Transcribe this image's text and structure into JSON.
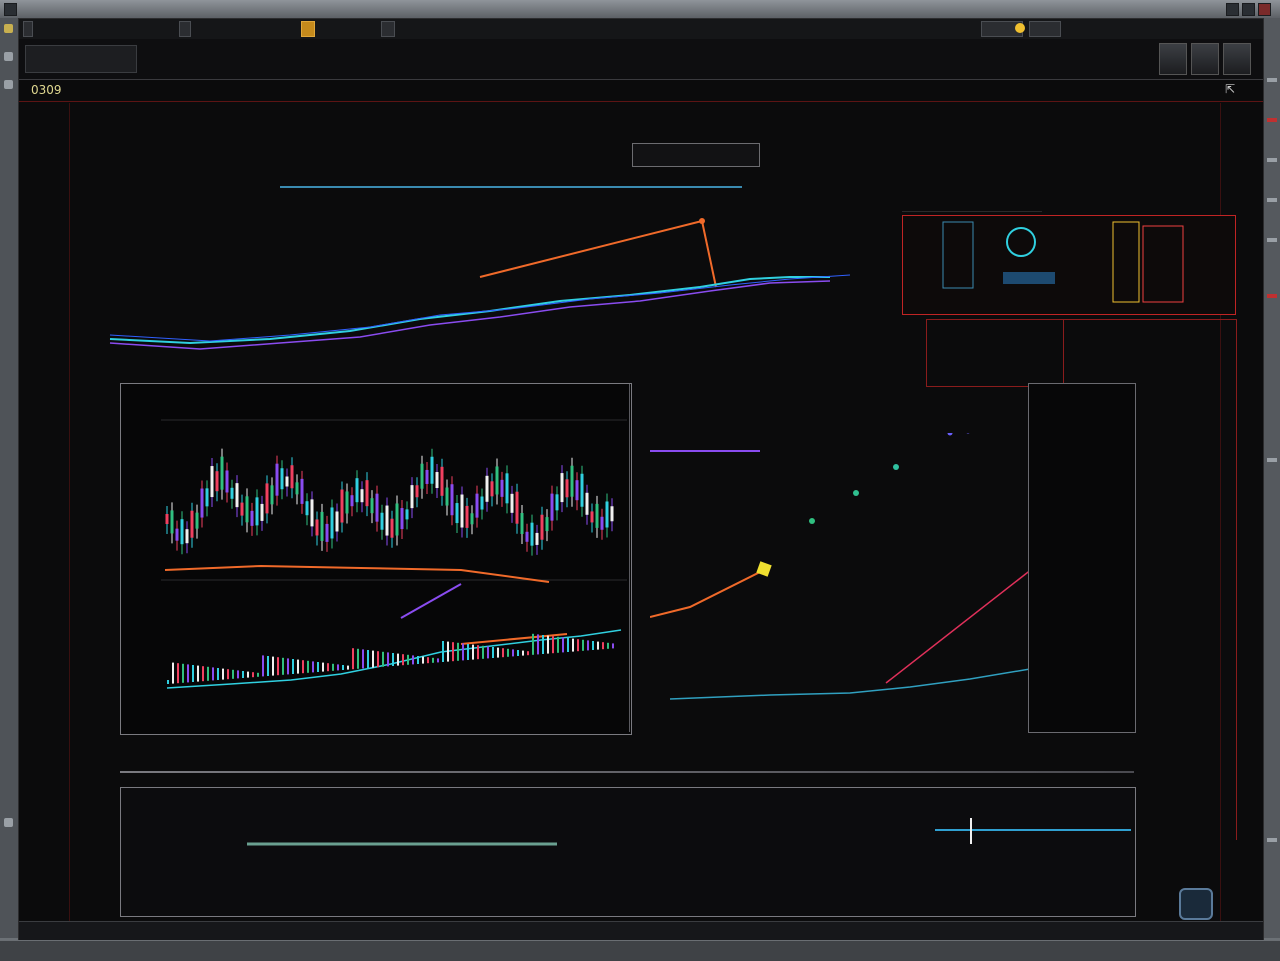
{
  "window": {
    "title": ""
  },
  "toolbar": {
    "tabs": [
      {
        "label": ""
      },
      {
        "label": ""
      }
    ]
  },
  "app_header": {
    "title": ""
  },
  "subbar": {
    "code": "0309"
  },
  "center_tabs": {
    "caption": "",
    "left_tab": "",
    "right_tab": ""
  },
  "ticker_rows": [],
  "chart_panel": {
    "sidebar_values": [],
    "left_labels": []
  },
  "right_panel": {
    "rows": []
  },
  "bottom_strip": {
    "left": "",
    "mid": "",
    "right": ""
  },
  "bottom_panel": {
    "title": "",
    "lines": [],
    "right_label": ""
  },
  "statusbar": {
    "left": ""
  },
  "taskbar": {
    "items": []
  },
  "colors": {
    "background": "#0b0b0c",
    "accent_orange": "#f06a2a",
    "accent_red": "#c02424",
    "accent_cyan": "#30d0e0",
    "accent_yellow": "#f0c030",
    "accent_violet": "#8a4cf0"
  },
  "icons": [
    "window-close-icon",
    "window-maximize-icon",
    "window-minimize-icon",
    "expand-icon",
    "tray-icon"
  ]
}
